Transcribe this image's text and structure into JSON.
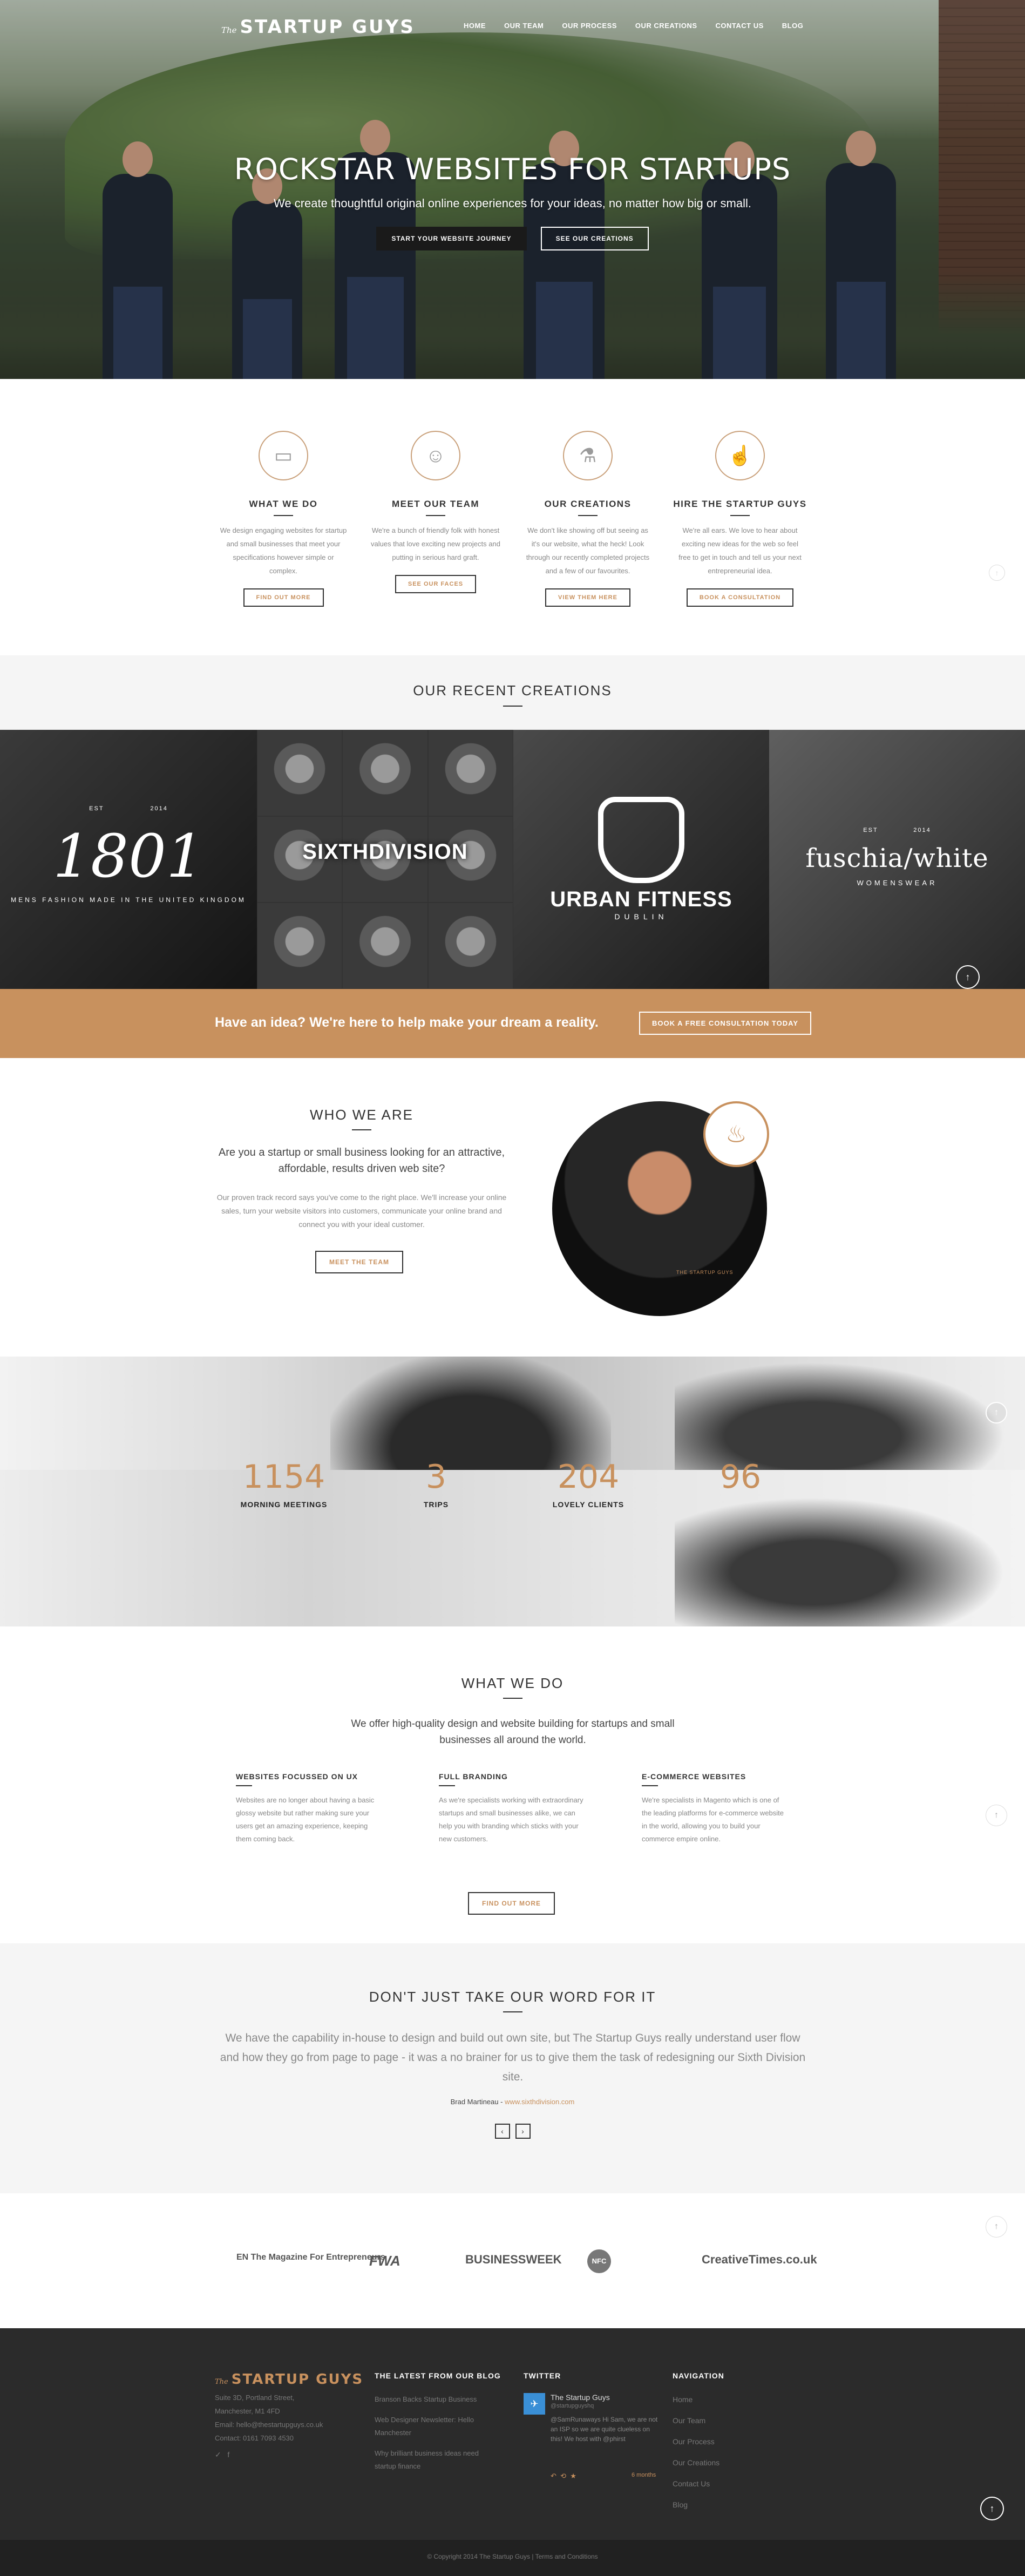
{
  "header": {
    "logo_prefix": "The",
    "logo_name": "STARTUP GUYS",
    "nav": [
      "HOME",
      "OUR TEAM",
      "OUR PROCESS",
      "OUR CREATIONS",
      "CONTACT US",
      "BLOG"
    ]
  },
  "hero": {
    "title": "ROCKSTAR WEBSITES FOR STARTUPS",
    "subtitle": "We create thoughtful original online experiences for your ideas, no matter how big or small.",
    "primary_button": "START YOUR WEBSITE JOURNEY",
    "secondary_button": "SEE OUR CREATIONS"
  },
  "services": [
    {
      "icon": "laptop-icon",
      "glyph": "▭",
      "title": "WHAT WE DO",
      "text": "We design engaging websites for startup and small businesses that meet your specifications however simple or complex.",
      "button": "FIND OUT MORE"
    },
    {
      "icon": "smiley-icon",
      "glyph": "☺",
      "title": "MEET OUR TEAM",
      "text": "We're a bunch of friendly folk with honest values that love exciting new projects and putting in serious hard graft.",
      "button": "SEE OUR FACES"
    },
    {
      "icon": "flask-icon",
      "glyph": "⚗",
      "title": "OUR CREATIONS",
      "text": "We don't like showing off but seeing as it's our website, what the heck! Look through our recently completed projects and a few of our favourites.",
      "button": "VIEW THEM HERE"
    },
    {
      "icon": "thumbs-up-icon",
      "glyph": "☝",
      "title": "HIRE THE STARTUP GUYS",
      "text": "We're all ears. We love to hear about exciting new ideas for the web so feel free to get in touch and tell us your next entrepreneurial idea.",
      "button": "BOOK A CONSULTATION"
    }
  ],
  "recent": {
    "title": "OUR RECENT CREATIONS",
    "tiles": [
      {
        "est_left": "EST",
        "est_right": "2014",
        "name": "1801",
        "tagline": "MENS FASHION MADE IN THE UNITED KINGDOM"
      },
      {
        "name": "SIXTHDIVISION"
      },
      {
        "name": "URBAN FITNESS",
        "tagline": "DUBLIN"
      },
      {
        "est_left": "EST",
        "est_right": "2014",
        "name": "fuschia/white",
        "tagline": "WOMENSWEAR"
      }
    ]
  },
  "cta": {
    "text": "Have an idea? We're here to help make your dream a reality.",
    "button": "BOOK A FREE CONSULTATION TODAY"
  },
  "who": {
    "title": "WHO WE ARE",
    "lead": "Are you a startup or small business looking for an attractive, affordable, results driven web site?",
    "body": "Our proven track record says you've come to the right place. We'll increase your online sales, turn your website visitors into customers, communicate your online brand and connect you with your ideal customer.",
    "button": "MEET THE TEAM",
    "shirt_text": "THE STARTUP GUYS"
  },
  "stats": [
    {
      "value": "1154",
      "label": "MORNING MEETINGS"
    },
    {
      "value": "3",
      "label": "TRIPS"
    },
    {
      "value": "204",
      "label": "LOVELY CLIENTS"
    },
    {
      "value": "96",
      "label": ""
    }
  ],
  "whatwedo": {
    "title": "WHAT WE DO",
    "lead": "We offer high-quality design and website building for startups and small businesses all around the world.",
    "columns": [
      {
        "title": "WEBSITES FOCUSSED ON UX",
        "text": "Websites are no longer about having a basic glossy website but rather making sure your users get an amazing experience, keeping them coming back."
      },
      {
        "title": "FULL BRANDING",
        "text": "As we're specialists working with extraordinary startups and small businesses alike, we can help you with branding which sticks with your new customers."
      },
      {
        "title": "E-COMMERCE WEBSITES",
        "text": "We're specialists in Magento which is one of the leading platforms for e-commerce website in the world, allowing you to build your commerce empire online."
      }
    ],
    "button": "FIND OUT MORE"
  },
  "testimonial": {
    "title": "DON'T JUST TAKE OUR WORD FOR IT",
    "quote": "We have the capability in-house to design and build out own site, but The Startup Guys really understand user flow and how they go from page to page - it was a no brainer for us to give them the task of redesigning our Sixth Division site.",
    "author": "Brad Martineau - ",
    "site": "www.sixthdivision.com",
    "prev": "‹",
    "next": "›"
  },
  "press": [
    "EN The Magazine For Entrepreneurs",
    "FWA",
    "BUSINESSWEEK",
    "NFC",
    "CreativeTimes.co.uk"
  ],
  "footer": {
    "logo_prefix": "The",
    "logo_name": "STARTUP GUYS",
    "address": [
      "Suite 3D, Portland Street,",
      "Manchester, M1 4FD",
      "Email: hello@thestartupguys.co.uk",
      "Contact: 0161 7093 4530"
    ],
    "blog_title": "THE LATEST FROM OUR BLOG",
    "blog_posts": [
      "Branson Backs Startup Business",
      "Web Designer Newsletter: Hello Manchester",
      "Why brilliant business ideas need startup finance"
    ],
    "twitter_title": "TWITTER",
    "tweet": {
      "name": "The Startup Guys",
      "handle": "@startupguyshq",
      "text": "@SamRunaways Hi Sam, we are not an ISP so we are quite clueless on this! We host with @phirst",
      "time": "6 months"
    },
    "nav_title": "NAVIGATION",
    "nav": [
      "Home",
      "Our Team",
      "Our Process",
      "Our Creations",
      "Contact Us",
      "Blog"
    ]
  },
  "copyright": "© Copyright 2014 The Startup Guys | Terms and Conditions",
  "colors": {
    "accent": "#c8915e",
    "dark": "#2b2b2b",
    "light": "#f5f5f5"
  }
}
